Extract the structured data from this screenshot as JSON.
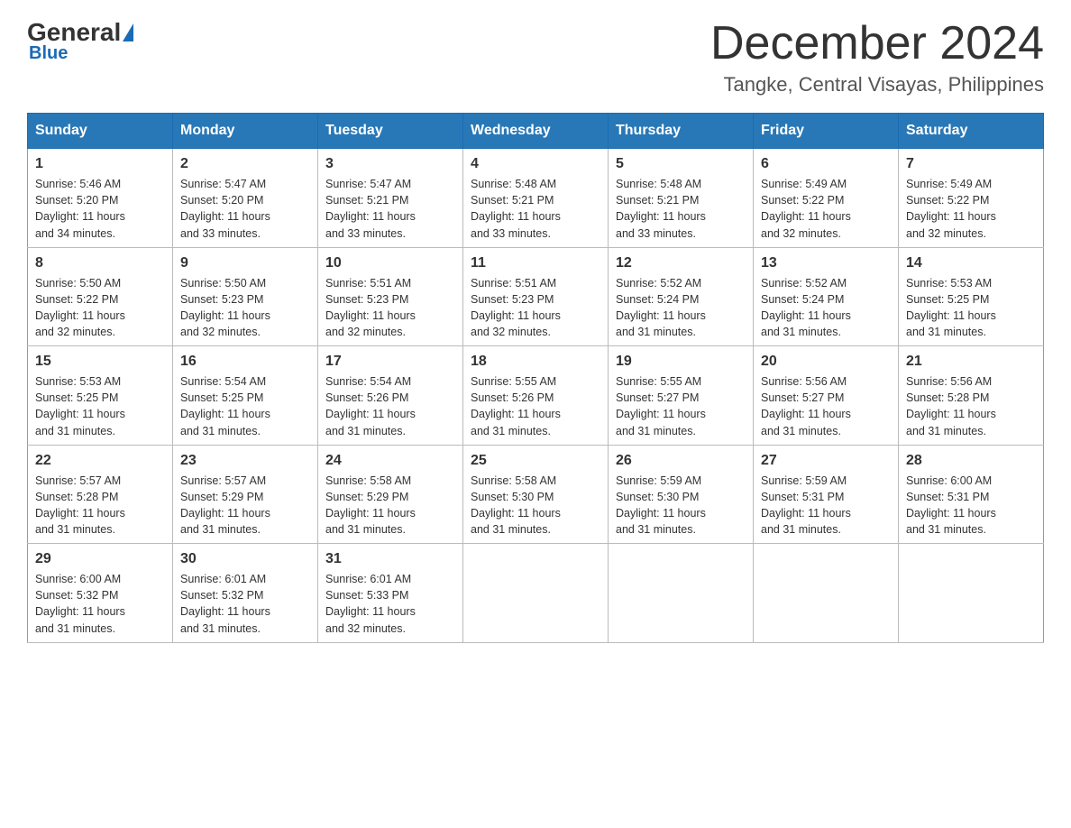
{
  "header": {
    "logo": {
      "general": "General",
      "blue": "Blue"
    },
    "month_title": "December 2024",
    "location": "Tangke, Central Visayas, Philippines"
  },
  "days_of_week": [
    "Sunday",
    "Monday",
    "Tuesday",
    "Wednesday",
    "Thursday",
    "Friday",
    "Saturday"
  ],
  "weeks": [
    [
      {
        "day": "1",
        "sunrise": "5:46 AM",
        "sunset": "5:20 PM",
        "daylight": "11 hours and 34 minutes."
      },
      {
        "day": "2",
        "sunrise": "5:47 AM",
        "sunset": "5:20 PM",
        "daylight": "11 hours and 33 minutes."
      },
      {
        "day": "3",
        "sunrise": "5:47 AM",
        "sunset": "5:21 PM",
        "daylight": "11 hours and 33 minutes."
      },
      {
        "day": "4",
        "sunrise": "5:48 AM",
        "sunset": "5:21 PM",
        "daylight": "11 hours and 33 minutes."
      },
      {
        "day": "5",
        "sunrise": "5:48 AM",
        "sunset": "5:21 PM",
        "daylight": "11 hours and 33 minutes."
      },
      {
        "day": "6",
        "sunrise": "5:49 AM",
        "sunset": "5:22 PM",
        "daylight": "11 hours and 32 minutes."
      },
      {
        "day": "7",
        "sunrise": "5:49 AM",
        "sunset": "5:22 PM",
        "daylight": "11 hours and 32 minutes."
      }
    ],
    [
      {
        "day": "8",
        "sunrise": "5:50 AM",
        "sunset": "5:22 PM",
        "daylight": "11 hours and 32 minutes."
      },
      {
        "day": "9",
        "sunrise": "5:50 AM",
        "sunset": "5:23 PM",
        "daylight": "11 hours and 32 minutes."
      },
      {
        "day": "10",
        "sunrise": "5:51 AM",
        "sunset": "5:23 PM",
        "daylight": "11 hours and 32 minutes."
      },
      {
        "day": "11",
        "sunrise": "5:51 AM",
        "sunset": "5:23 PM",
        "daylight": "11 hours and 32 minutes."
      },
      {
        "day": "12",
        "sunrise": "5:52 AM",
        "sunset": "5:24 PM",
        "daylight": "11 hours and 31 minutes."
      },
      {
        "day": "13",
        "sunrise": "5:52 AM",
        "sunset": "5:24 PM",
        "daylight": "11 hours and 31 minutes."
      },
      {
        "day": "14",
        "sunrise": "5:53 AM",
        "sunset": "5:25 PM",
        "daylight": "11 hours and 31 minutes."
      }
    ],
    [
      {
        "day": "15",
        "sunrise": "5:53 AM",
        "sunset": "5:25 PM",
        "daylight": "11 hours and 31 minutes."
      },
      {
        "day": "16",
        "sunrise": "5:54 AM",
        "sunset": "5:25 PM",
        "daylight": "11 hours and 31 minutes."
      },
      {
        "day": "17",
        "sunrise": "5:54 AM",
        "sunset": "5:26 PM",
        "daylight": "11 hours and 31 minutes."
      },
      {
        "day": "18",
        "sunrise": "5:55 AM",
        "sunset": "5:26 PM",
        "daylight": "11 hours and 31 minutes."
      },
      {
        "day": "19",
        "sunrise": "5:55 AM",
        "sunset": "5:27 PM",
        "daylight": "11 hours and 31 minutes."
      },
      {
        "day": "20",
        "sunrise": "5:56 AM",
        "sunset": "5:27 PM",
        "daylight": "11 hours and 31 minutes."
      },
      {
        "day": "21",
        "sunrise": "5:56 AM",
        "sunset": "5:28 PM",
        "daylight": "11 hours and 31 minutes."
      }
    ],
    [
      {
        "day": "22",
        "sunrise": "5:57 AM",
        "sunset": "5:28 PM",
        "daylight": "11 hours and 31 minutes."
      },
      {
        "day": "23",
        "sunrise": "5:57 AM",
        "sunset": "5:29 PM",
        "daylight": "11 hours and 31 minutes."
      },
      {
        "day": "24",
        "sunrise": "5:58 AM",
        "sunset": "5:29 PM",
        "daylight": "11 hours and 31 minutes."
      },
      {
        "day": "25",
        "sunrise": "5:58 AM",
        "sunset": "5:30 PM",
        "daylight": "11 hours and 31 minutes."
      },
      {
        "day": "26",
        "sunrise": "5:59 AM",
        "sunset": "5:30 PM",
        "daylight": "11 hours and 31 minutes."
      },
      {
        "day": "27",
        "sunrise": "5:59 AM",
        "sunset": "5:31 PM",
        "daylight": "11 hours and 31 minutes."
      },
      {
        "day": "28",
        "sunrise": "6:00 AM",
        "sunset": "5:31 PM",
        "daylight": "11 hours and 31 minutes."
      }
    ],
    [
      {
        "day": "29",
        "sunrise": "6:00 AM",
        "sunset": "5:32 PM",
        "daylight": "11 hours and 31 minutes."
      },
      {
        "day": "30",
        "sunrise": "6:01 AM",
        "sunset": "5:32 PM",
        "daylight": "11 hours and 31 minutes."
      },
      {
        "day": "31",
        "sunrise": "6:01 AM",
        "sunset": "5:33 PM",
        "daylight": "11 hours and 32 minutes."
      },
      null,
      null,
      null,
      null
    ]
  ],
  "labels": {
    "sunrise": "Sunrise:",
    "sunset": "Sunset:",
    "daylight": "Daylight:"
  }
}
